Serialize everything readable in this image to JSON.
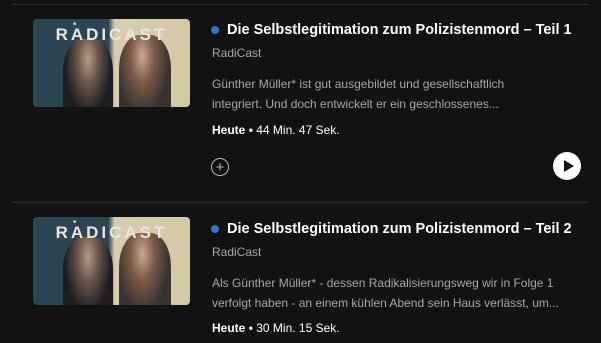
{
  "episodes": [
    {
      "cover_text": "RADICAST",
      "title": "Die Selbstlegitimation zum Polizistenmord – Teil 1",
      "show": "RadiCast",
      "description_line1": "Günther Müller* ist gut ausgebildet und gesellschaftlich",
      "description_line2": "integriert. Und doch entwickelt er ein geschlossenes...",
      "date": "Heute",
      "duration": "44 Min. 47 Sek.",
      "unplayed_color": "#2e77d0"
    },
    {
      "cover_text": "RADICAST",
      "title": "Die Selbstlegitimation zum Polizistenmord – Teil 2",
      "show": "RadiCast",
      "description_line1": "Als Günther Müller* - dessen Radikalisierungsweg wir in Folge 1",
      "description_line2": "verfolgt haben - an einem kühlen Abend sein Haus verlässt, um...",
      "date": "Heute",
      "duration": "30 Min. 15 Sek.",
      "unplayed_color": "#2e77d0"
    }
  ],
  "icons": {
    "add": "plus-circle-icon",
    "play": "play-icon"
  },
  "separator": "•"
}
